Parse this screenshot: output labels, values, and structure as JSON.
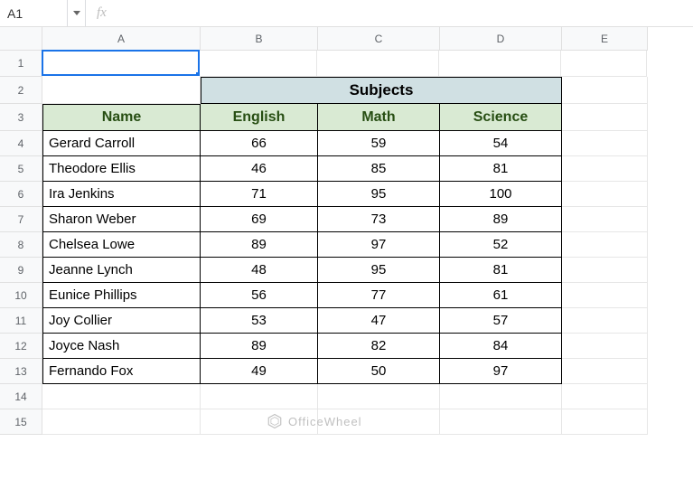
{
  "namebox": {
    "ref": "A1"
  },
  "fx": {
    "label": "fx",
    "value": ""
  },
  "columns": [
    "A",
    "B",
    "C",
    "D",
    "E"
  ],
  "rows": [
    "1",
    "2",
    "3",
    "4",
    "5",
    "6",
    "7",
    "8",
    "9",
    "10",
    "11",
    "12",
    "13",
    "14",
    "15"
  ],
  "headers": {
    "subjects_merged": "Subjects",
    "name": "Name",
    "english": "English",
    "math": "Math",
    "science": "Science"
  },
  "data": [
    {
      "name": "Gerard Carroll",
      "english": "66",
      "math": "59",
      "science": "54"
    },
    {
      "name": "Theodore Ellis",
      "english": "46",
      "math": "85",
      "science": "81"
    },
    {
      "name": "Ira Jenkins",
      "english": "71",
      "math": "95",
      "science": "100"
    },
    {
      "name": "Sharon Weber",
      "english": "69",
      "math": "73",
      "science": "89"
    },
    {
      "name": "Chelsea Lowe",
      "english": "89",
      "math": "97",
      "science": "52"
    },
    {
      "name": "Jeanne Lynch",
      "english": "48",
      "math": "95",
      "science": "81"
    },
    {
      "name": "Eunice Phillips",
      "english": "56",
      "math": "77",
      "science": "61"
    },
    {
      "name": "Joy Collier",
      "english": "53",
      "math": "47",
      "science": "57"
    },
    {
      "name": "Joyce Nash",
      "english": "89",
      "math": "82",
      "science": "84"
    },
    {
      "name": "Fernando Fox",
      "english": "49",
      "math": "50",
      "science": "97"
    }
  ],
  "watermark": {
    "text": "OfficeWheel"
  }
}
